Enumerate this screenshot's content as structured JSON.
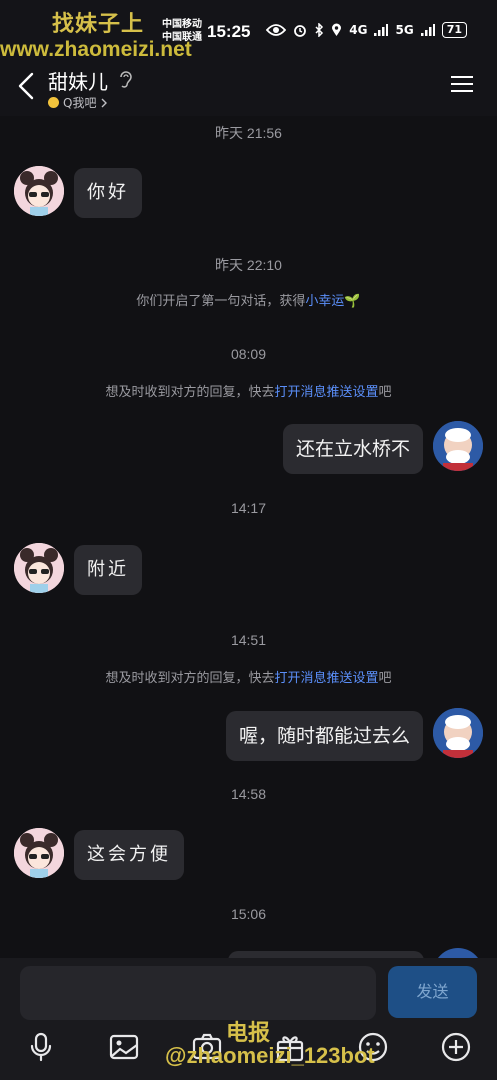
{
  "watermark": {
    "top": "找妹子上",
    "url": "www.zhaomeizi.net",
    "bottom1": "电报",
    "bottom2": "@zhaomeizi_123bot"
  },
  "statusbar": {
    "carrier1": "中国移动",
    "carrier2": "中国联通",
    "time": "15:25",
    "net1": "4G",
    "net2": "5G",
    "battery": "71"
  },
  "header": {
    "title": "甜妹儿",
    "subtitle": "Q我吧"
  },
  "messages": {
    "t1": "昨天 21:56",
    "m1": "你好",
    "t2": "昨天 22:10",
    "sys1_prefix": "你们开启了第一句对话，获得",
    "sys1_link": "小幸运",
    "sys1_emoji": "🌱",
    "t3": "08:09",
    "sys2_prefix": "想及时收到对方的回复，快去",
    "sys2_link": "打开消息推送设置",
    "sys2_suffix": "吧",
    "m2": "还在立水桥不",
    "t4": "14:17",
    "m3": "附近",
    "t5": "14:51",
    "sys3_prefix": "想及时收到对方的回复，快去",
    "sys3_link": "打开消息推送设置",
    "sys3_suffix": "吧",
    "m4": "喔，随时都能过去么",
    "t6": "14:58",
    "m5": "这会方便",
    "t7": "15:06"
  },
  "input": {
    "placeholder": "",
    "send_label": "发送"
  }
}
